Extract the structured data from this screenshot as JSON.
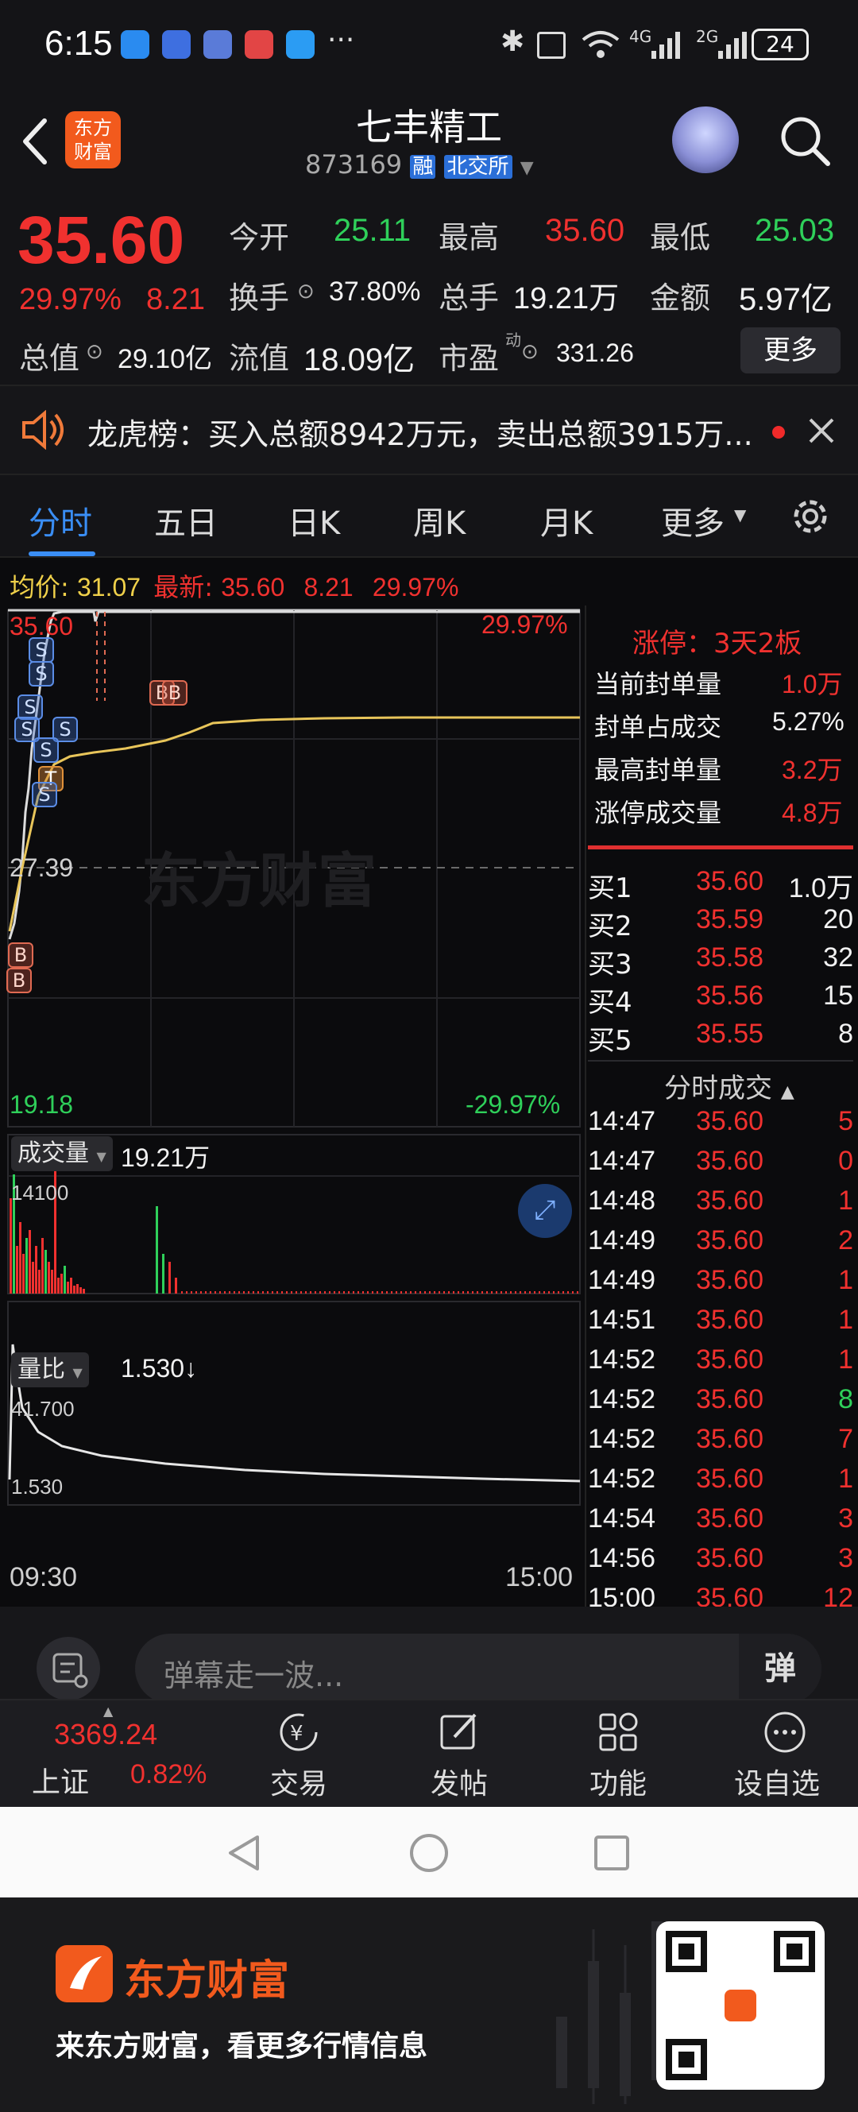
{
  "status_bar": {
    "time": "6:15",
    "network1": "4G",
    "network2": "2G",
    "battery": "24"
  },
  "header": {
    "title": "七丰精工",
    "code": "873169",
    "rong_badge": "融",
    "exchange": "北交所"
  },
  "quote": {
    "price": "35.60",
    "change_pct": "29.97%",
    "change": "8.21",
    "open_label": "今开",
    "open": "25.11",
    "high_label": "最高",
    "high": "35.60",
    "low_label": "最低",
    "low": "25.03",
    "turnover_label": "换手",
    "turnover": "37.80%",
    "volume_label": "总手",
    "volume": "19.21万",
    "amount_label": "金额",
    "amount": "5.97亿",
    "mktcap_label": "总值",
    "mktcap": "29.10亿",
    "float_label": "流值",
    "float_cap": "18.09亿",
    "pe_label": "市盈",
    "pe_sup": "动",
    "pe": "331.26",
    "more_button": "更多"
  },
  "notice": {
    "text": "龙虎榜：买入总额8942万元，卖出总额3915万..."
  },
  "tabs": [
    {
      "label": "分时"
    },
    {
      "label": "五日"
    },
    {
      "label": "日K"
    },
    {
      "label": "周K"
    },
    {
      "label": "月K"
    },
    {
      "label": "更多"
    }
  ],
  "chart_info": {
    "avg_label": "均价:",
    "avg_value": "31.07",
    "latest_label": "最新:",
    "latest_value": "35.60",
    "latest_change": "8.21",
    "latest_pct": "29.97%"
  },
  "price_chart": {
    "top_price": "35.60",
    "top_pct": "29.97%",
    "mid_price": "27.39",
    "bottom_price": "19.18",
    "bottom_pct": "-29.97%",
    "watermark": "东方财富"
  },
  "limit_panel": {
    "title": "涨停：3天2板",
    "rows": [
      {
        "label": "当前封单量",
        "value": "1.0万"
      },
      {
        "label": "封单占成交",
        "value": "5.27%"
      },
      {
        "label": "最高封单量",
        "value": "3.2万"
      },
      {
        "label": "涨停成交量",
        "value": "4.8万"
      }
    ]
  },
  "order_book": [
    {
      "label": "买1",
      "price": "35.60",
      "qty": "1.0万"
    },
    {
      "label": "买2",
      "price": "35.59",
      "qty": "20"
    },
    {
      "label": "买3",
      "price": "35.58",
      "qty": "32"
    },
    {
      "label": "买4",
      "price": "35.56",
      "qty": "15"
    },
    {
      "label": "买5",
      "price": "35.55",
      "qty": "8"
    }
  ],
  "trades": {
    "title": "分时成交",
    "rows": [
      {
        "time": "14:47",
        "price": "35.60",
        "qty": "5"
      },
      {
        "time": "14:47",
        "price": "35.60",
        "qty": "0"
      },
      {
        "time": "14:48",
        "price": "35.60",
        "qty": "1"
      },
      {
        "time": "14:49",
        "price": "35.60",
        "qty": "2"
      },
      {
        "time": "14:49",
        "price": "35.60",
        "qty": "1"
      },
      {
        "time": "14:51",
        "price": "35.60",
        "qty": "1"
      },
      {
        "time": "14:52",
        "price": "35.60",
        "qty": "1"
      },
      {
        "time": "14:52",
        "price": "35.60",
        "qty": "8"
      },
      {
        "time": "14:52",
        "price": "35.60",
        "qty": "7"
      },
      {
        "time": "14:52",
        "price": "35.60",
        "qty": "1"
      },
      {
        "time": "14:54",
        "price": "35.60",
        "qty": "3"
      },
      {
        "time": "14:56",
        "price": "35.60",
        "qty": "3"
      },
      {
        "time": "15:00",
        "price": "35.60",
        "qty": "12"
      }
    ]
  },
  "volume_panel": {
    "label": "成交量",
    "value": "19.21万",
    "max": "14100"
  },
  "ratio_panel": {
    "label": "量比",
    "value": "1.530↓",
    "max": "41.700",
    "min": "1.530"
  },
  "time_axis": {
    "start": "09:30",
    "end": "15:00"
  },
  "comment": {
    "placeholder": "弹幕走一波...",
    "dan_button": "弹"
  },
  "bottom_nav": {
    "index_value": "3369.24",
    "index_name": "上证",
    "index_pct": "0.82%",
    "items": [
      {
        "label": "交易"
      },
      {
        "label": "发帖"
      },
      {
        "label": "功能"
      },
      {
        "label": "设自选"
      }
    ]
  },
  "ad": {
    "brand": "东方财富",
    "slogan": "来东方财富，看更多行情信息",
    "logo_text": "东方\n财富"
  },
  "colors": {
    "up": "#f0312f",
    "down": "#2fd05a",
    "accent": "#3a8ef5",
    "avg_line": "#e8c55a"
  }
}
